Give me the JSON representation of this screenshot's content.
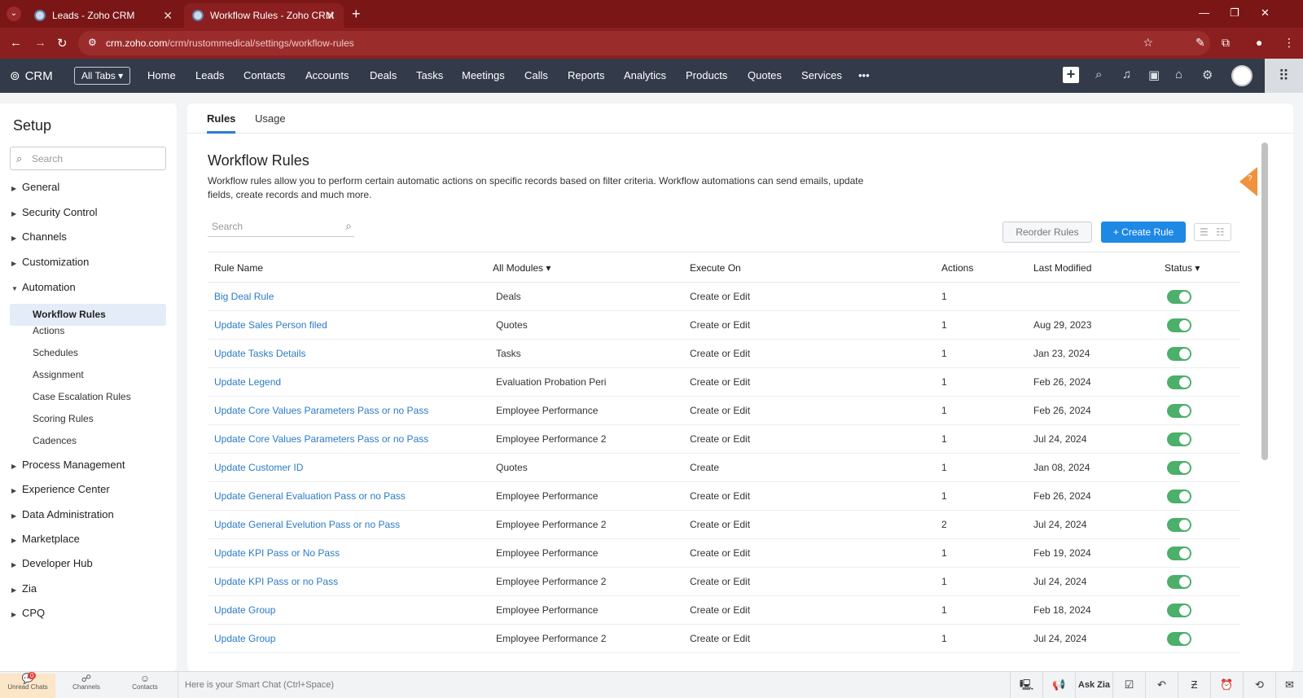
{
  "browser": {
    "tabs": [
      {
        "title": "Leads - Zoho CRM",
        "active": false
      },
      {
        "title": "Workflow Rules - Zoho CRM",
        "active": true
      }
    ],
    "url_domain": "crm.zoho.com",
    "url_path": "/crm/rustommedical/settings/workflow-rules"
  },
  "crm": {
    "logo": "CRM",
    "all_tabs": "All Tabs",
    "nav": [
      "Home",
      "Leads",
      "Contacts",
      "Accounts",
      "Deals",
      "Tasks",
      "Meetings",
      "Calls",
      "Reports",
      "Analytics",
      "Products",
      "Quotes",
      "Services",
      "•••"
    ]
  },
  "sidebar": {
    "title": "Setup",
    "search_placeholder": "Search",
    "sections": [
      "General",
      "Security Control",
      "Channels",
      "Customization",
      "Automation"
    ],
    "automation_items": [
      "Workflow Rules",
      "Actions",
      "Schedules",
      "Assignment",
      "Case Escalation Rules",
      "Scoring Rules",
      "Cadences"
    ],
    "more_sections": [
      "Process Management",
      "Experience Center",
      "Data Administration",
      "Marketplace",
      "Developer Hub",
      "Zia",
      "CPQ"
    ]
  },
  "main": {
    "tabs": [
      "Rules",
      "Usage"
    ],
    "title": "Workflow Rules",
    "description": "Workflow rules allow you to perform certain automatic actions on specific records based on filter criteria. Workflow automations can send emails, update fields, create records and much more.",
    "search_placeholder": "Search",
    "reorder_label": "Reorder Rules",
    "create_label": "+ Create Rule",
    "columns": [
      "Rule Name",
      "All Modules ▾",
      "Execute On",
      "Actions",
      "Last Modified",
      "Status ▾"
    ],
    "rows": [
      {
        "name": "Big Deal Rule",
        "module": "Deals",
        "execute": "Create or Edit",
        "actions": "1",
        "modified": ""
      },
      {
        "name": "Update Sales Person filed",
        "module": "Quotes",
        "execute": "Create or Edit",
        "actions": "1",
        "modified": "Aug 29, 2023"
      },
      {
        "name": "Update Tasks Details",
        "module": "Tasks",
        "execute": "Create or Edit",
        "actions": "1",
        "modified": "Jan 23, 2024"
      },
      {
        "name": "Update Legend",
        "module": "Evaluation Probation Peri",
        "execute": "Create or Edit",
        "actions": "1",
        "modified": "Feb 26, 2024"
      },
      {
        "name": "Update Core Values Parameters Pass or no Pass",
        "module": "Employee Performance",
        "execute": "Create or Edit",
        "actions": "1",
        "modified": "Feb 26, 2024"
      },
      {
        "name": "Update Core Values Parameters Pass or no Pass",
        "module": "Employee Performance 2",
        "execute": "Create or Edit",
        "actions": "1",
        "modified": "Jul 24, 2024"
      },
      {
        "name": "Update Customer ID",
        "module": "Quotes",
        "execute": "Create",
        "actions": "1",
        "modified": "Jan 08, 2024"
      },
      {
        "name": "Update General Evaluation Pass or no Pass",
        "module": "Employee Performance",
        "execute": "Create or Edit",
        "actions": "1",
        "modified": "Feb 26, 2024"
      },
      {
        "name": "Update General Evelution Pass or no Pass",
        "module": "Employee Performance 2",
        "execute": "Create or Edit",
        "actions": "2",
        "modified": "Jul 24, 2024"
      },
      {
        "name": "Update KPI Pass or No Pass",
        "module": "Employee Performance",
        "execute": "Create or Edit",
        "actions": "1",
        "modified": "Feb 19, 2024"
      },
      {
        "name": "Update KPI Pass or no Pass",
        "module": "Employee Performance 2",
        "execute": "Create or Edit",
        "actions": "1",
        "modified": "Jul 24, 2024"
      },
      {
        "name": "Update Group",
        "module": "Employee Performance",
        "execute": "Create or Edit",
        "actions": "1",
        "modified": "Feb 18, 2024"
      },
      {
        "name": "Update Group",
        "module": "Employee Performance 2",
        "execute": "Create or Edit",
        "actions": "1",
        "modified": "Jul 24, 2024"
      }
    ]
  },
  "bottom": {
    "items": [
      "Unread Chats",
      "Channels",
      "Contacts"
    ],
    "unread_count": "0",
    "smart_chat": "Here is your Smart Chat (Ctrl+Space)",
    "ask_zia": "Ask Zia"
  },
  "colors": {
    "accent": "#1e88e5",
    "link": "#2b7bc6",
    "toggle_on": "#4caf6a",
    "nav_bg": "#333b4a",
    "browser_bg": "#8b1f1f"
  }
}
